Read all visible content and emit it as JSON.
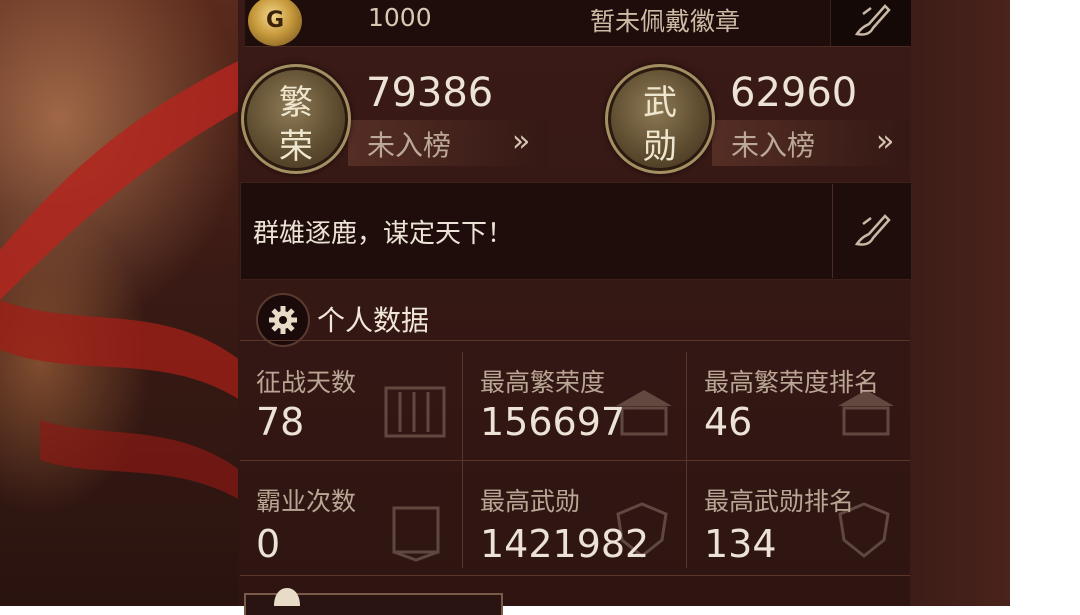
{
  "colors": {
    "panel_bg": "#2e1512",
    "text_primary": "#ece3d6",
    "text_secondary": "#b9a694",
    "medal_border": "#a48f63"
  },
  "badge": {
    "logo_glyph": "G",
    "value": "1000",
    "status": "暂未佩戴徽章",
    "edit_icon": "brush-icon"
  },
  "stats": [
    {
      "medal_chars": [
        "繁",
        "荣"
      ],
      "value": "79386",
      "rank": "未入榜",
      "more": "»"
    },
    {
      "medal_chars": [
        "武",
        "勋"
      ],
      "value": "62960",
      "rank": "未入榜",
      "more": "»"
    }
  ],
  "motto": {
    "text": "群雄逐鹿，谋定天下！",
    "edit_icon": "brush-icon"
  },
  "personal_data": {
    "title": "个人数据",
    "icon": "gear-icon",
    "cells": [
      {
        "label": "征战天数",
        "value": "78"
      },
      {
        "label": "最高繁荣度",
        "value": "156697"
      },
      {
        "label": "最高繁荣度排名",
        "value": "46"
      },
      {
        "label": "霸业次数",
        "value": "0"
      },
      {
        "label": "最高武勋",
        "value": "1421982"
      },
      {
        "label": "最高武勋排名",
        "value": "134"
      }
    ]
  }
}
